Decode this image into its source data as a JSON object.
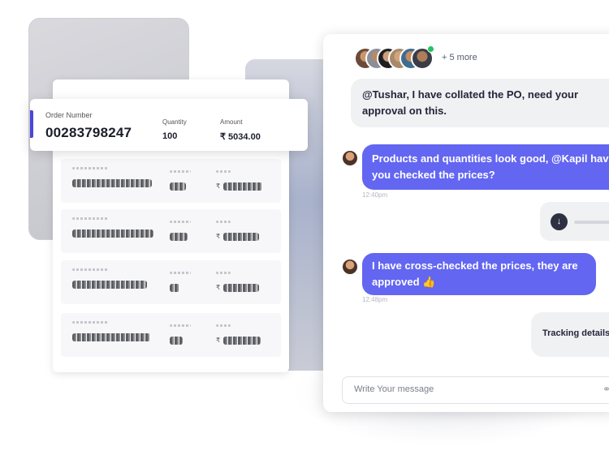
{
  "order_card": {
    "order_number_label": "Order Number",
    "order_number": "00283798247",
    "quantity_label": "Quantity",
    "quantity": "100",
    "amount_label": "Amount",
    "amount": "₹ 5034.00"
  },
  "order_list": {
    "currency_symbol": "₹"
  },
  "chat": {
    "more_participants": "+ 5 more",
    "messages": [
      {
        "text": "@Tushar, I have collated the PO, need your approval on this."
      },
      {
        "text": "Products and quantities look good, @Kapil have you checked the prices?",
        "time": "12:40pm"
      },
      {
        "text": "I have cross-checked the prices, they are approved 👍",
        "time": "12:48pm"
      }
    ],
    "tracking_text": "Tracking details",
    "compose_placeholder": "Write Your message"
  },
  "icons": {
    "play": "play-arrow-icon",
    "attach": "paperclip-icon"
  },
  "colors": {
    "accent": "#6366f1",
    "order_accent": "#4a46d8",
    "online": "#22c55e"
  }
}
